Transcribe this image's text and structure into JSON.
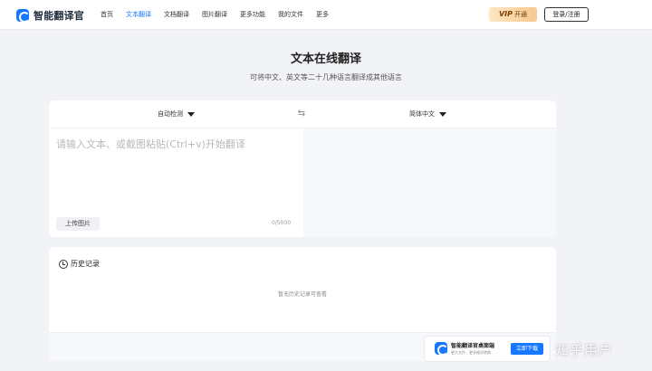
{
  "header": {
    "logo_text": "智能翻译官",
    "nav": [
      {
        "label": "首页"
      },
      {
        "label": "文本翻译",
        "active": true
      },
      {
        "label": "文档翻译"
      },
      {
        "label": "图片翻译"
      },
      {
        "label": "更多功能"
      },
      {
        "label": "我的文件"
      },
      {
        "label": "更多"
      }
    ],
    "vip_badge": "VIP",
    "vip_label": "开通",
    "login_label": "登录/注册"
  },
  "main": {
    "title": "文本在线翻译",
    "subtitle": "可将中文、英文等二十几种语言翻译成其他语言"
  },
  "translator": {
    "source_lang": "自动检测",
    "target_lang": "简体中文",
    "placeholder": "请输入文本、或截图粘贴(Ctrl+v)开始翻译",
    "upload_label": "上传图片",
    "char_count": "0/5000"
  },
  "history": {
    "title": "历史记录",
    "empty_text": "暂无历史记录可查看"
  },
  "promo": {
    "title": "智能翻译官桌面端",
    "subtitle": "更大文件，更多格式转换",
    "button_label": "立即下载"
  },
  "watermark": "知乎用户",
  "colors": {
    "accent": "#1677ff",
    "background": "#f2f3f6"
  }
}
